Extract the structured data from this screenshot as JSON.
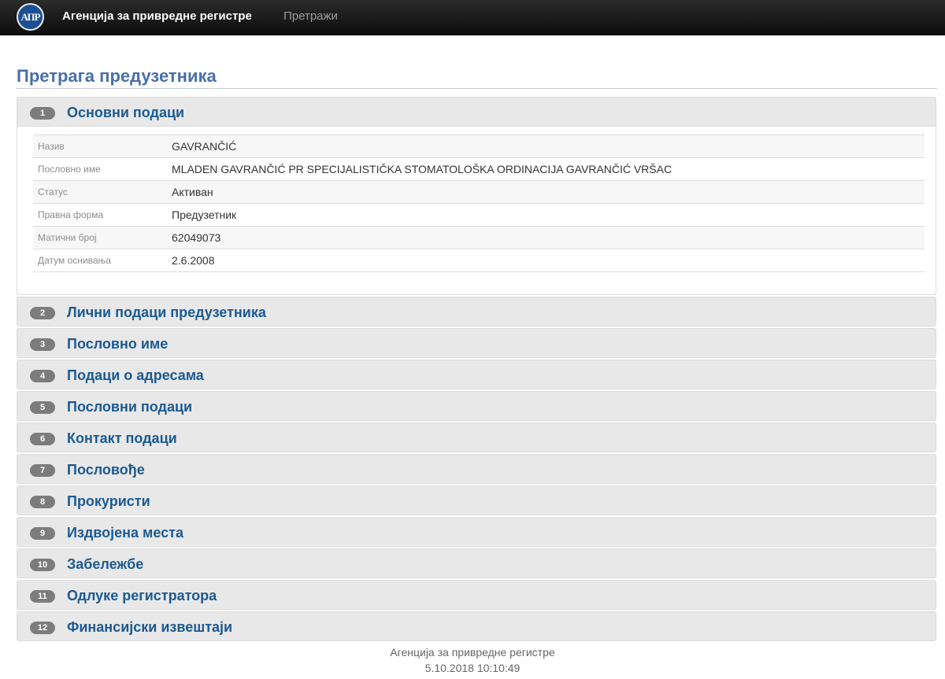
{
  "navbar": {
    "logo_text": "АПР",
    "brand": "Агенција за привредне регистре",
    "search_link": "Претражи"
  },
  "page": {
    "title": "Претрага предузетника"
  },
  "sections": [
    {
      "num": "1",
      "title": "Основни подаци",
      "expanded": true
    },
    {
      "num": "2",
      "title": "Лични подаци предузетника"
    },
    {
      "num": "3",
      "title": "Пословно име"
    },
    {
      "num": "4",
      "title": "Подаци о адресама"
    },
    {
      "num": "5",
      "title": "Пословни подаци"
    },
    {
      "num": "6",
      "title": "Контакт подаци"
    },
    {
      "num": "7",
      "title": "Пословође"
    },
    {
      "num": "8",
      "title": "Прокуристи"
    },
    {
      "num": "9",
      "title": "Издвојена места"
    },
    {
      "num": "10",
      "title": "Забележбе"
    },
    {
      "num": "11",
      "title": "Одлуке регистратора"
    },
    {
      "num": "12",
      "title": "Финансијски извештаји"
    }
  ],
  "basic_info": [
    {
      "label": "Назив",
      "value": "GAVRANČIĆ"
    },
    {
      "label": "Пословно име",
      "value": "MLADEN GAVRANČIĆ PR SPECIJALISTIČKA STOMATOLOŠKA ORDINACIJA GAVRANČIĆ VRŠAC"
    },
    {
      "label": "Статус",
      "value": "Активан"
    },
    {
      "label": "Правна форма",
      "value": "Предузетник"
    },
    {
      "label": "Матични број",
      "value": "62049073"
    },
    {
      "label": "Датум оснивања",
      "value": "2.6.2008"
    }
  ],
  "footer": {
    "org": "Агенција за привредне регистре",
    "timestamp": "5.10.2018 10:10:49"
  }
}
